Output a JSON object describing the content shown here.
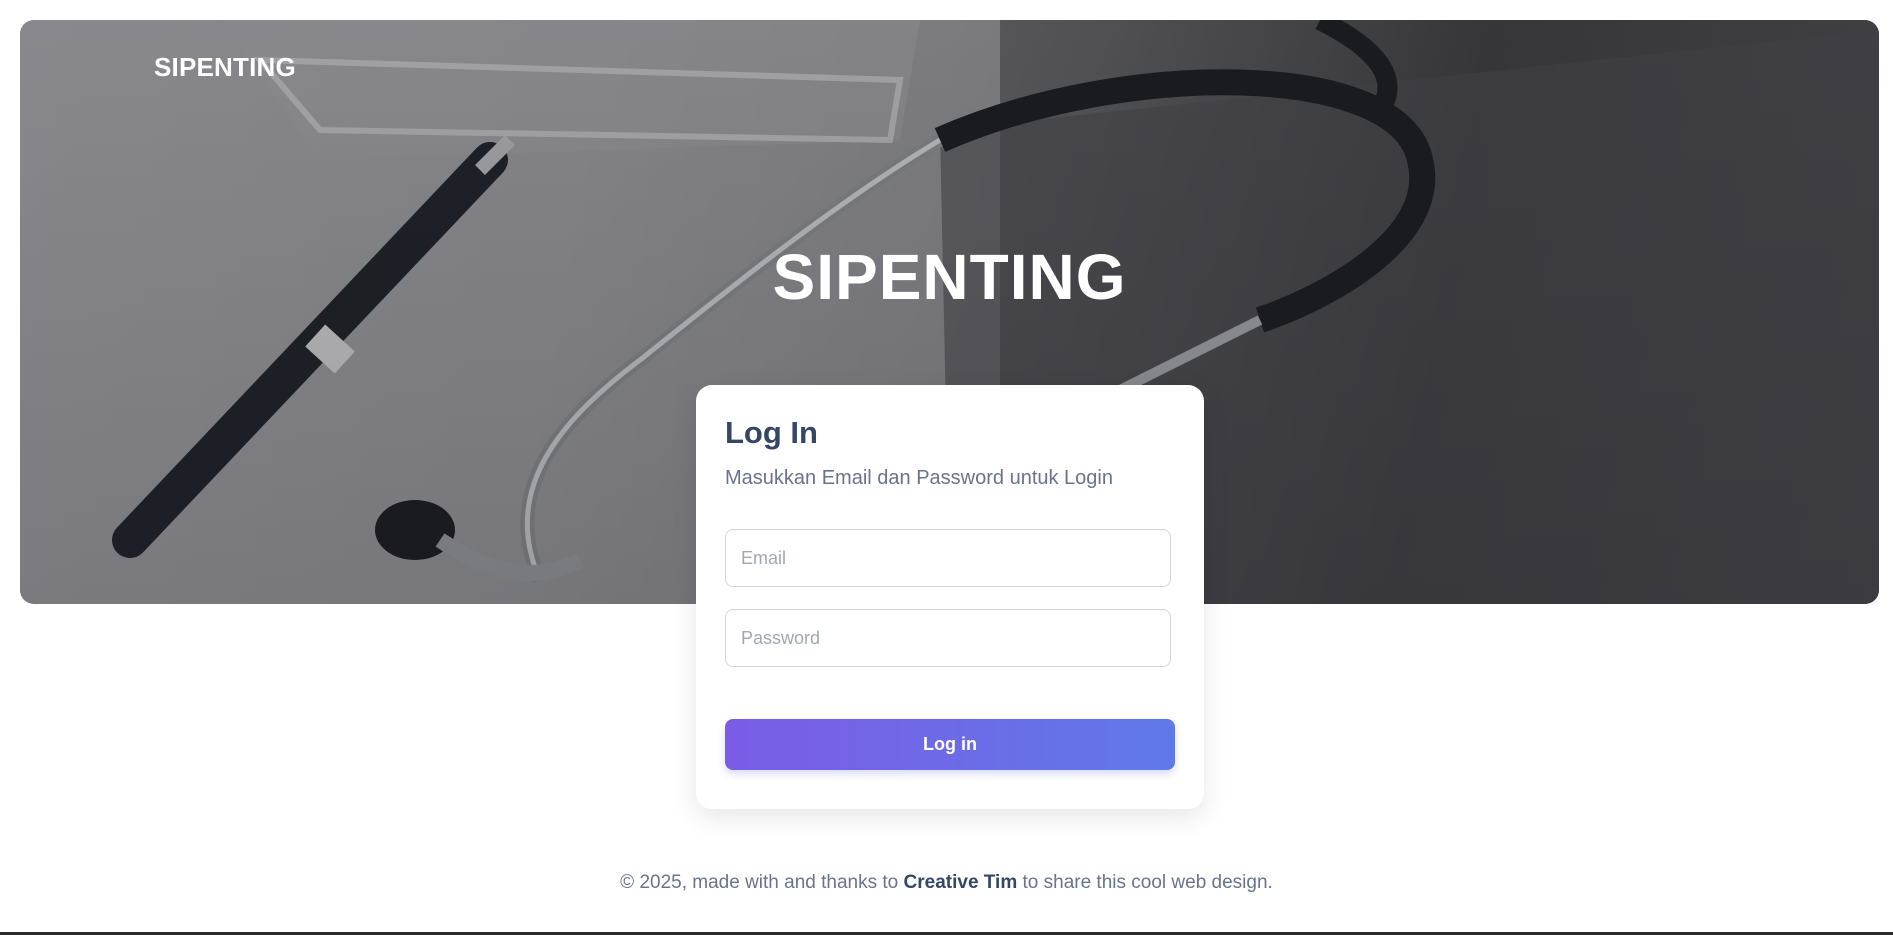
{
  "navbar": {
    "brand": "SIPENTING"
  },
  "hero": {
    "title": "SIPENTING"
  },
  "login_card": {
    "title": "Log In",
    "subtitle": "Masukkan Email dan Password untuk Login",
    "email_placeholder": "Email",
    "password_placeholder": "Password",
    "submit_label": "Log in"
  },
  "footer": {
    "prefix": "© 2025, made with and thanks to",
    "link_text": "Creative Tim",
    "suffix": "to share this cool web design."
  },
  "colors": {
    "primary_gradient_start": "#7b5ce6",
    "primary_gradient_end": "#5f79e8",
    "heading": "#344767",
    "muted_text": "#67748e"
  }
}
